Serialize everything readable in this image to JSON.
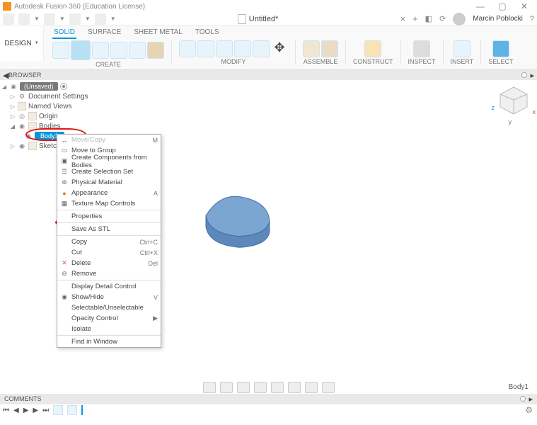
{
  "window": {
    "title": "Autodesk Fusion 360 (Education License)"
  },
  "document": {
    "name": "Untitled*",
    "close_x": "×"
  },
  "user": {
    "name": "Marcin Poblocki"
  },
  "design_btn": "DESIGN",
  "tabs": [
    "SOLID",
    "SURFACE",
    "SHEET METAL",
    "TOOLS"
  ],
  "tool_groups": [
    "CREATE",
    "MODIFY",
    "ASSEMBLE",
    "CONSTRUCT",
    "INSPECT",
    "INSERT",
    "SELECT"
  ],
  "browser_label": "BROWSER",
  "tree": {
    "root": "(Unsaved)",
    "items": [
      "Document Settings",
      "Named Views",
      "Origin",
      "Bodies",
      "Body1",
      "Sketches"
    ]
  },
  "context_menu": [
    {
      "label": "Move/Copy",
      "shortcut": "M",
      "icon": "↔"
    },
    {
      "label": "Move to Group",
      "icon": "▭"
    },
    {
      "label": "Create Components from Bodies",
      "icon": "▣"
    },
    {
      "label": "Create Selection Set",
      "icon": "☰"
    },
    {
      "label": "Physical Material",
      "icon": "⊚"
    },
    {
      "label": "Appearance",
      "shortcut": "A",
      "icon": "●"
    },
    {
      "label": "Texture Map Controls",
      "icon": "▦"
    },
    {
      "label": "Properties"
    },
    {
      "label": "Save As STL"
    },
    {
      "label": "Copy",
      "shortcut": "Ctrl+C"
    },
    {
      "label": "Cut",
      "shortcut": "Ctrl+X"
    },
    {
      "label": "Delete",
      "shortcut": "Del",
      "icon": "✕"
    },
    {
      "label": "Remove",
      "icon": "⊖"
    },
    {
      "label": "Display Detail Control"
    },
    {
      "label": "Show/Hide",
      "shortcut": "V",
      "icon": "◉"
    },
    {
      "label": "Selectable/Unselectable"
    },
    {
      "label": "Opacity Control",
      "arrow": "▶"
    },
    {
      "label": "Isolate"
    },
    {
      "label": "Find in Window"
    }
  ],
  "status_body": "Body1",
  "comments_label": "COMMENTS",
  "axes": {
    "x": "x",
    "y": "y",
    "z": "z"
  }
}
